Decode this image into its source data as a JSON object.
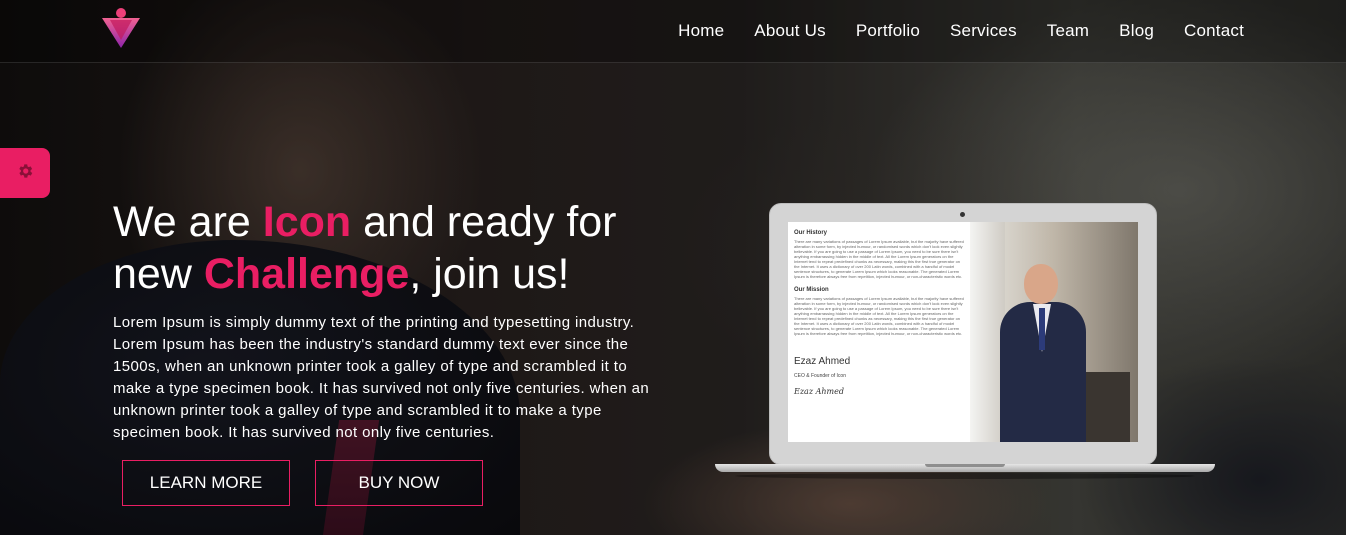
{
  "header": {
    "logo_icon": "triangle-logo-icon",
    "nav": [
      {
        "label": "Home"
      },
      {
        "label": "About Us"
      },
      {
        "label": "Portfolio"
      },
      {
        "label": "Services"
      },
      {
        "label": "Team"
      },
      {
        "label": "Blog"
      },
      {
        "label": "Contact"
      }
    ]
  },
  "settings": {
    "icon": "gear-icon"
  },
  "hero": {
    "title_part1": "We are ",
    "title_hl1": "Icon",
    "title_part2": " and ready for new ",
    "title_hl2": "Challenge",
    "title_part3": ", join us!",
    "description": "Lorem Ipsum is simply dummy text of the printing and typesetting industry. Lorem Ipsum has been the industry's standard dummy text ever since the 1500s, when an unknown printer took a galley of type and scrambled it to make a type specimen book. It has survived not only five centuries. when an unknown printer took a galley of type and scrambled it to make a type specimen book. It has survived not only five centuries.",
    "learn_more": "LEARN MORE",
    "buy_now": "BUY NOW"
  },
  "laptop_screen": {
    "history_heading": "Our History",
    "history_text": "There are many variations of passages of Lorem Ipsum available, but the majority have suffered alteration in some form, by injected humour, or randomised words which don't look even slightly believable. If you are going to use a passage of Lorem Ipsum, you need to be sure there isn't anything embarrassing hidden in the middle of text. All the Lorem Ipsum generators on the Internet tend to repeat predefined chunks as necessary, making this the first true generator on the Internet. It uses a dictionary of over 200 Latin words, combined with a handful of model sentence structures, to generate Lorem Ipsum which looks reasonable. The generated Lorem Ipsum is therefore always free from repetition, injected humour, or non-characteristic words etc.",
    "mission_heading": "Our Mission",
    "mission_text": "There are many variations of passages of Lorem Ipsum available, but the majority have suffered alteration in some form, by injected humour, or randomised words which don't look even slightly believable. If you are going to use a passage of Lorem Ipsum, you need to be sure there isn't anything embarrassing hidden in the middle of text. All the Lorem Ipsum generators on the Internet tend to repeat predefined chunks as necessary, making this the first true generator on the Internet. It uses a dictionary of over 200 Latin words, combined with a handful of model sentence structures, to generate Lorem Ipsum which looks reasonable. The generated Lorem Ipsum is therefore always free from repetition, injected humour, or non-characteristic words etc.",
    "name": "Ezaz Ahmed",
    "role": "CEO & Founder of Icon",
    "signature": "Ezaz Ahmed"
  },
  "colors": {
    "accent": "#e91e63",
    "text": "#ffffff"
  }
}
